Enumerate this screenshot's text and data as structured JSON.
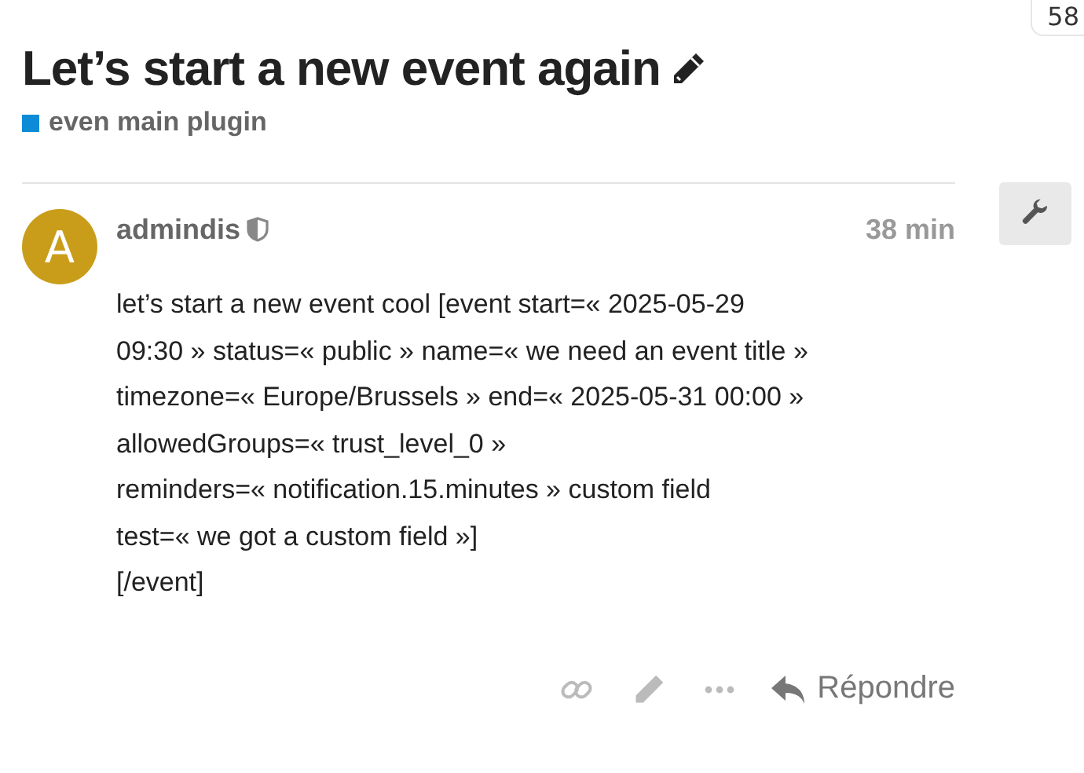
{
  "corner_badge": "58",
  "topic": {
    "title": "Let’s start a new event again",
    "category": {
      "name": "even main plugin",
      "color": "#0e8bd6"
    }
  },
  "post": {
    "avatar_letter": "A",
    "username": "admindis",
    "time": "38 min",
    "body_lines": [
      "let’s start a new event cool [event start=« 2025-05-29",
      "09:30 » status=« public » name=« we need an event title »",
      "timezone=« Europe/Brussels » end=« 2025-05-31 00:00 »",
      "allowedGroups=« trust_level_0 »",
      "reminders=« notification.15.minutes » custom field",
      "test=« we got a custom field »]",
      "[/event]"
    ],
    "reply_label": "Répondre"
  }
}
